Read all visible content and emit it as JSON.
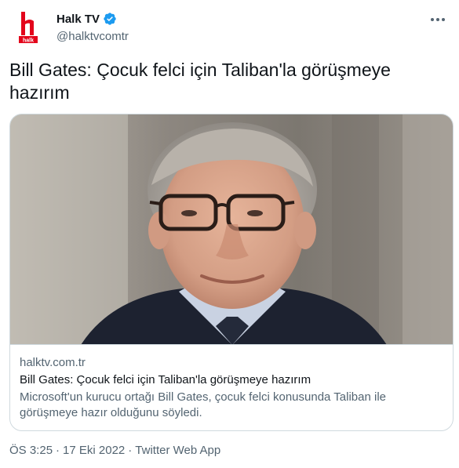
{
  "author": {
    "display_name": "Halk TV",
    "handle": "@halktvcomtr",
    "logo_text": "halk",
    "verified_icon": "verified-badge-icon",
    "avatar_icon": "halk-tv-logo"
  },
  "tweet": {
    "text": "Bill Gates: Çocuk felci için Taliban'la görüşmeye hazırım"
  },
  "card": {
    "domain": "halktv.com.tr",
    "title": "Bill Gates: Çocuk felci için Taliban'la görüşmeye hazırım",
    "description": "Microsoft'un kurucu ortağı Bill Gates, çocuk felci konusunda Taliban ile görüşmeye hazır olduğunu söyledi.",
    "image_icon": "news-photo"
  },
  "meta": {
    "time": "ÖS 3:25",
    "separator": "·",
    "date": "17 Eki 2022",
    "source": "Twitter Web App"
  },
  "colors": {
    "accent": "#1d9bf0",
    "brand": "#e3051b",
    "text": "#0f1419",
    "secondary": "#536471",
    "border": "#cfd9de"
  }
}
